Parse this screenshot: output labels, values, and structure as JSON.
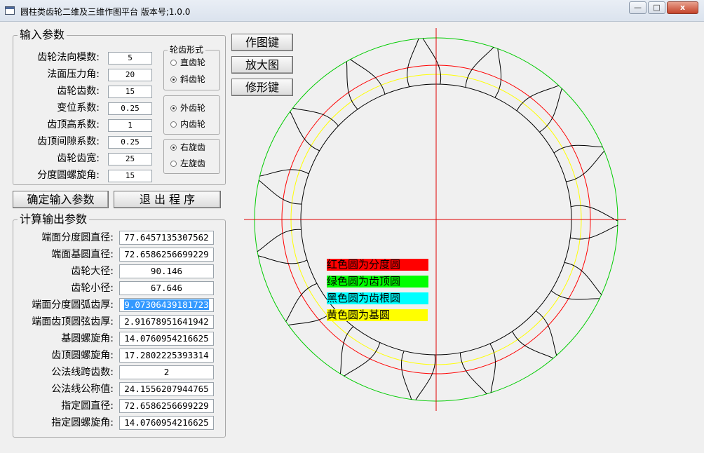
{
  "window": {
    "title": "圆柱类齿轮二维及三维作图平台 版本号;1.0.0",
    "buttons": {
      "minimize": "—",
      "maximize": "□",
      "close": "x"
    }
  },
  "input_group": {
    "title": "输入参数",
    "fields": [
      {
        "label": "齿轮法向模数:",
        "value": "5"
      },
      {
        "label": "法面压力角:",
        "value": "20"
      },
      {
        "label": "齿轮齿数:",
        "value": "15"
      },
      {
        "label": "变位系数:",
        "value": "0.25"
      },
      {
        "label": "齿顶高系数:",
        "value": "1"
      },
      {
        "label": "齿顶间隙系数:",
        "value": "0.25"
      },
      {
        "label": "齿轮齿宽:",
        "value": "25"
      },
      {
        "label": "分度圆螺旋角:",
        "value": "15"
      }
    ]
  },
  "tooth_form": {
    "title": "轮齿形式",
    "straight": "直齿轮",
    "helical": "斜齿轮",
    "selected": "helical"
  },
  "gear_type": {
    "external": "外齿轮",
    "internal": "内齿轮",
    "selected": "external"
  },
  "helix_dir": {
    "right": "右旋齿",
    "left": "左旋齿",
    "selected": "right"
  },
  "actions": {
    "confirm": "确定输入参数",
    "exit": "退 出 程 序"
  },
  "output_group": {
    "title": "计算输出参数",
    "fields": [
      {
        "label": "端面分度圆直径:",
        "value": "77.6457135307562"
      },
      {
        "label": "端面基圆直径:",
        "value": "72.6586256699229"
      },
      {
        "label": "齿轮大径:",
        "value": "90.146"
      },
      {
        "label": "齿轮小径:",
        "value": "67.646"
      },
      {
        "label": "端面分度圆弧齿厚:",
        "value": "9.07306439181723"
      },
      {
        "label": "端面齿顶圆弦齿厚:",
        "value": "2.91678951641942"
      },
      {
        "label": "基圆螺旋角:",
        "value": "14.0760954216625"
      },
      {
        "label": "齿顶圆螺旋角:",
        "value": "17.2802225393314"
      },
      {
        "label": "公法线跨齿数:",
        "value": "2"
      },
      {
        "label": "公法线公称值:",
        "value": "24.1556207944765"
      },
      {
        "label": "指定圆直径:",
        "value": "72.6586256699229"
      },
      {
        "label": "指定圆螺旋角:",
        "value": "14.0760954216625"
      }
    ]
  },
  "tools": {
    "draw": "作图键",
    "zoom": "放大图",
    "modify": "修形键"
  },
  "drawing": {
    "teeth": 15,
    "legend": [
      {
        "text": "红色圆为分度圆",
        "color": "#ff0000"
      },
      {
        "text": "绿色圆为齿顶圆",
        "color": "#00ff00"
      },
      {
        "text": "黑色圆为齿根圆",
        "color": "#00ffff"
      },
      {
        "text": "黄色圆为基圆",
        "color": "#ffff00"
      }
    ],
    "circle_colors": {
      "pitch": "#ff0000",
      "tip": "#00cc00",
      "root": "#000000",
      "base": "#ffff00"
    }
  }
}
